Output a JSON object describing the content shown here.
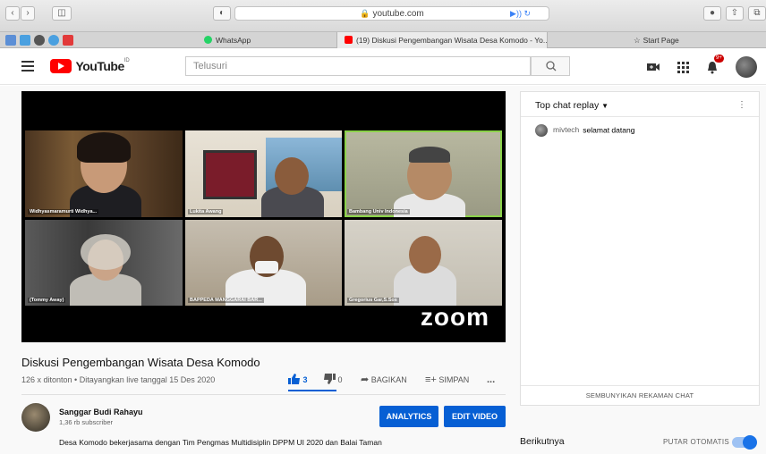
{
  "browser": {
    "url": "youtube.com",
    "tabs": [
      {
        "label": "WhatsApp"
      },
      {
        "label": "(19) Diskusi Pengembangan Wisata Desa Komodo - Yo..."
      },
      {
        "label": "Start Page"
      }
    ]
  },
  "header": {
    "logo_text": "YouTube",
    "logo_region": "ID",
    "search_placeholder": "Telusuri",
    "notification_count": "9+"
  },
  "video": {
    "zoom_logo": "zoom",
    "participants": [
      {
        "name": "Widhyasmaramurti Widhya..."
      },
      {
        "name": "Lukita Awang"
      },
      {
        "name": "Bambang Univ Indonesia"
      },
      {
        "name": "(Tommy Away)"
      },
      {
        "name": "BAPPEDA MANGGARAI BAR..."
      },
      {
        "name": "Gregorius Gar,S.Sos"
      }
    ],
    "title": "Diskusi Pengembangan Wisata Desa Komodo",
    "meta": "126 x ditonton • Ditayangkan live tanggal 15 Des 2020",
    "likes": "3",
    "dislikes": "0",
    "share_label": "BAGIKAN",
    "save_label": "SIMPAN",
    "more_label": "..."
  },
  "channel": {
    "name": "Sanggar Budi Rahayu",
    "subscribers": "1,36 rb subscriber",
    "analytics_label": "ANALYTICS",
    "edit_label": "EDIT VIDEO",
    "description": "Desa Komodo bekerjasama dengan Tim Pengmas Multidisiplin DPPM UI 2020 dan Balai Taman"
  },
  "chat": {
    "title": "Top chat replay",
    "messages": [
      {
        "author": "mivtech",
        "text": "selamat datang"
      }
    ],
    "hide_label": "SEMBUNYIKAN REKAMAN CHAT"
  },
  "sidebar": {
    "next_label": "Berikutnya",
    "autoplay_label": "PUTAR OTOMATIS",
    "autoplay_on": true
  },
  "colors": {
    "brand_red": "#ff0000",
    "accent_blue": "#065fd4",
    "speaker_outline": "#8bd24a"
  }
}
